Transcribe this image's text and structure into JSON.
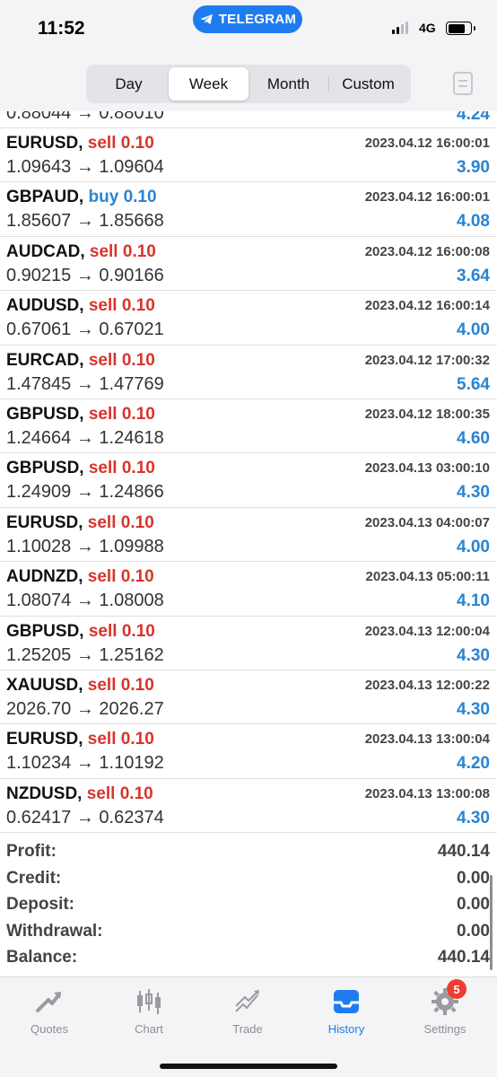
{
  "status_bar": {
    "time": "11:52",
    "pill_label": "TELEGRAM",
    "network": "4G"
  },
  "period_tabs": [
    {
      "label": "Day",
      "active": false
    },
    {
      "label": "Week",
      "active": true
    },
    {
      "label": "Month",
      "active": false
    },
    {
      "label": "Custom",
      "active": false
    }
  ],
  "partial_row": {
    "prices": "0.88044 → 0.88010",
    "profit": "4.24"
  },
  "deals": [
    {
      "symbol": "EURUSD,",
      "side": "sell",
      "volume": "0.10",
      "time": "2023.04.12 16:00:01",
      "prices": "1.09643 → 1.09604",
      "profit": "3.90"
    },
    {
      "symbol": "GBPAUD,",
      "side": "buy",
      "volume": "0.10",
      "time": "2023.04.12 16:00:01",
      "prices": "1.85607 → 1.85668",
      "profit": "4.08"
    },
    {
      "symbol": "AUDCAD,",
      "side": "sell",
      "volume": "0.10",
      "time": "2023.04.12 16:00:08",
      "prices": "0.90215 → 0.90166",
      "profit": "3.64"
    },
    {
      "symbol": "AUDUSD,",
      "side": "sell",
      "volume": "0.10",
      "time": "2023.04.12 16:00:14",
      "prices": "0.67061 → 0.67021",
      "profit": "4.00"
    },
    {
      "symbol": "EURCAD,",
      "side": "sell",
      "volume": "0.10",
      "time": "2023.04.12 17:00:32",
      "prices": "1.47845 → 1.47769",
      "profit": "5.64"
    },
    {
      "symbol": "GBPUSD,",
      "side": "sell",
      "volume": "0.10",
      "time": "2023.04.12 18:00:35",
      "prices": "1.24664 → 1.24618",
      "profit": "4.60"
    },
    {
      "symbol": "GBPUSD,",
      "side": "sell",
      "volume": "0.10",
      "time": "2023.04.13 03:00:10",
      "prices": "1.24909 → 1.24866",
      "profit": "4.30"
    },
    {
      "symbol": "EURUSD,",
      "side": "sell",
      "volume": "0.10",
      "time": "2023.04.13 04:00:07",
      "prices": "1.10028 → 1.09988",
      "profit": "4.00"
    },
    {
      "symbol": "AUDNZD,",
      "side": "sell",
      "volume": "0.10",
      "time": "2023.04.13 05:00:11",
      "prices": "1.08074 → 1.08008",
      "profit": "4.10"
    },
    {
      "symbol": "GBPUSD,",
      "side": "sell",
      "volume": "0.10",
      "time": "2023.04.13 12:00:04",
      "prices": "1.25205 → 1.25162",
      "profit": "4.30"
    },
    {
      "symbol": "XAUUSD,",
      "side": "sell",
      "volume": "0.10",
      "time": "2023.04.13 12:00:22",
      "prices": "2026.70 → 2026.27",
      "profit": "4.30"
    },
    {
      "symbol": "EURUSD,",
      "side": "sell",
      "volume": "0.10",
      "time": "2023.04.13 13:00:04",
      "prices": "1.10234 → 1.10192",
      "profit": "4.20"
    },
    {
      "symbol": "NZDUSD,",
      "side": "sell",
      "volume": "0.10",
      "time": "2023.04.13 13:00:08",
      "prices": "0.62417 → 0.62374",
      "profit": "4.30"
    }
  ],
  "summary": [
    {
      "label": "Profit:",
      "value": "440.14"
    },
    {
      "label": "Credit:",
      "value": "0.00"
    },
    {
      "label": "Deposit:",
      "value": "0.00"
    },
    {
      "label": "Withdrawal:",
      "value": "0.00"
    },
    {
      "label": "Balance:",
      "value": "440.14"
    }
  ],
  "tabbar": [
    {
      "label": "Quotes",
      "icon": "quotes-icon",
      "active": false
    },
    {
      "label": "Chart",
      "icon": "candlestick-chart-icon",
      "active": false
    },
    {
      "label": "Trade",
      "icon": "trade-icon",
      "active": false
    },
    {
      "label": "History",
      "icon": "inbox-history-icon",
      "active": true
    },
    {
      "label": "Settings",
      "icon": "gear-icon",
      "active": false,
      "badge": "5"
    }
  ],
  "colors": {
    "sell": "#d8342c",
    "buy": "#2a84d0",
    "profit": "#2a84d0",
    "accent": "#1f7cf0"
  }
}
